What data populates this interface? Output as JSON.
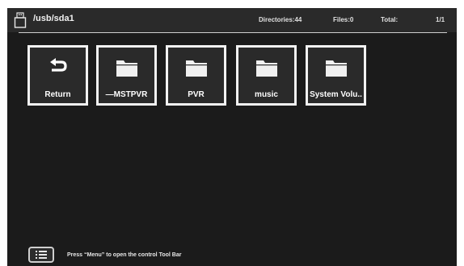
{
  "header": {
    "icon": "usb-drive-icon",
    "path": "/usb/sda1",
    "directories": "Directories:44",
    "files": "Files:0",
    "total": "Total:",
    "page": "1/1"
  },
  "tiles": [
    {
      "label": "Return",
      "icon": "return-arrow-icon"
    },
    {
      "label": "—MSTPVR",
      "icon": "folder-icon"
    },
    {
      "label": "PVR",
      "icon": "folder-icon"
    },
    {
      "label": "music",
      "icon": "folder-icon"
    },
    {
      "label": "System Volu..",
      "icon": "folder-icon"
    }
  ],
  "footer": {
    "menu_icon": "list-menu-icon",
    "hint": "Press “Menu” to open the control Tool Bar"
  },
  "colors": {
    "background": "#1b1b1b",
    "header": "#2a2a2a",
    "tile_border": "#f2f2f2",
    "text": "#ffffff"
  }
}
